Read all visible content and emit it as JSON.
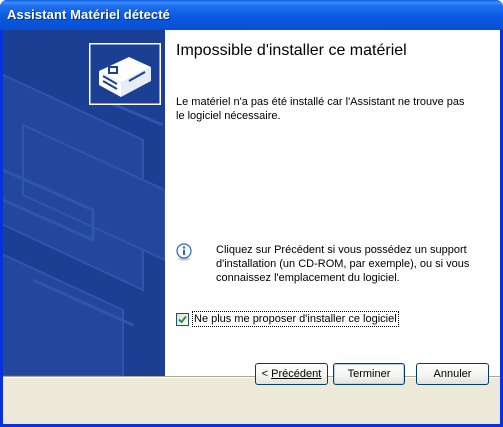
{
  "window": {
    "title": "Assistant Matériel détecté"
  },
  "main": {
    "heading": "Impossible d'installer ce matériel",
    "description": "Le matériel n'a pas été installé car l'Assistant ne trouve pas le logiciel nécessaire.",
    "info_text": "Cliquez sur Précédent si vous possédez un support d'installation (un CD-ROM, par exemple), ou si vous connaissez l'emplacement du logiciel.",
    "checkbox_label": "Ne plus me proposer d'installer ce logiciel",
    "checkbox_checked": true
  },
  "buttons": {
    "prev": "Précédent",
    "prev_prefix": "< ",
    "finish": "Terminer",
    "cancel": "Annuler"
  },
  "icons": {
    "hardware": "hardware-device-icon",
    "info": "info-icon",
    "check": "checkmark-icon"
  }
}
